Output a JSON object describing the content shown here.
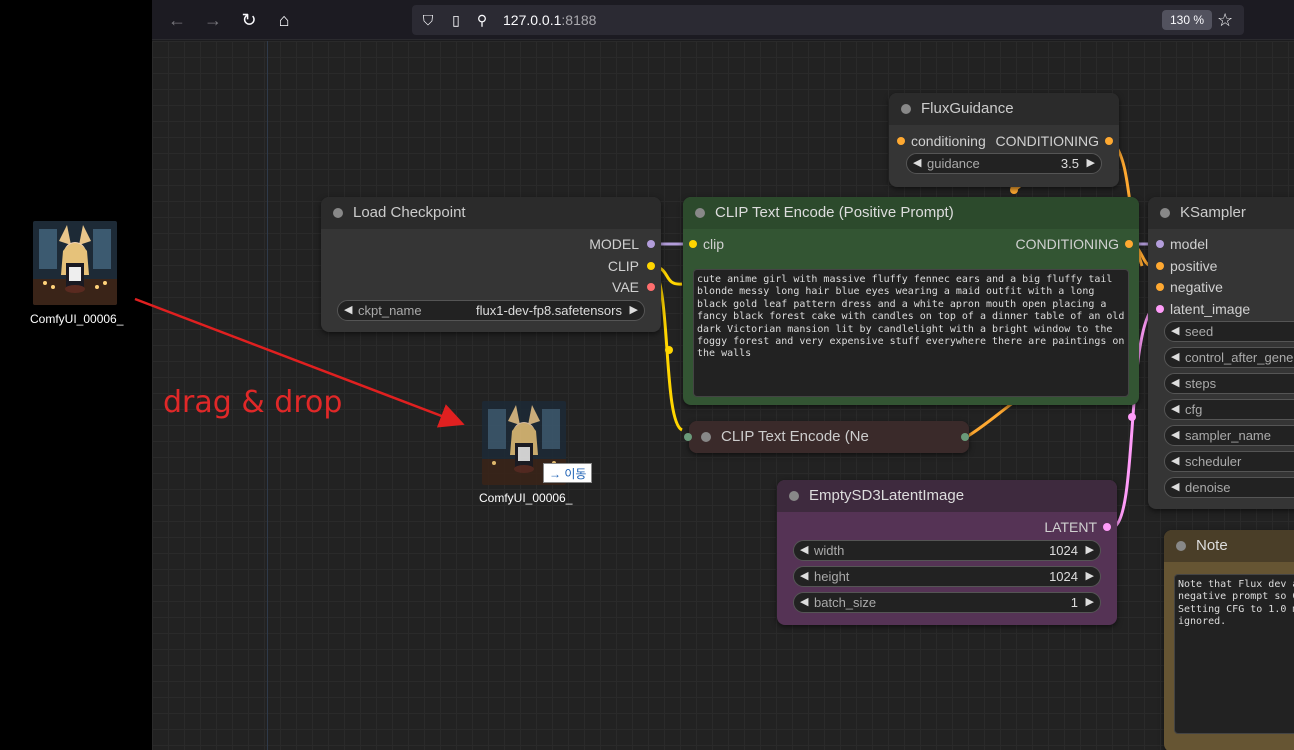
{
  "desktop": {
    "file_label": "ComfyUI_00006_",
    "drag_label": "drag & drop",
    "drag_tooltip": "→ 이동"
  },
  "browser": {
    "url_host": "127.0.0.1",
    "url_port": ":8188",
    "zoom": "130 %"
  },
  "nodes": {
    "flux_guidance": {
      "title": "FluxGuidance",
      "input": "conditioning",
      "output": "CONDITIONING",
      "widget_label": "guidance",
      "widget_value": "3.5"
    },
    "load_checkpoint": {
      "title": "Load Checkpoint",
      "outputs": [
        "MODEL",
        "CLIP",
        "VAE"
      ],
      "widget_label": "ckpt_name",
      "widget_value": "flux1-dev-fp8.safetensors"
    },
    "clip_positive": {
      "title": "CLIP Text Encode (Positive Prompt)",
      "input": "clip",
      "output": "CONDITIONING",
      "prompt": "cute anime girl with massive fluffy fennec ears and a big fluffy tail blonde messy long hair blue eyes wearing a maid outfit with a long black gold leaf pattern dress and a white apron mouth open placing a fancy black forest cake with candles on top of a dinner table of an old dark Victorian mansion lit by candlelight with a bright window to the foggy forest and very expensive stuff everywhere there are paintings on the walls"
    },
    "clip_negative": {
      "title": "CLIP Text Encode (Ne"
    },
    "ksampler": {
      "title": "KSampler",
      "inputs": [
        "model",
        "positive",
        "negative",
        "latent_image"
      ],
      "widgets": [
        "seed",
        "control_after_gene",
        "steps",
        "cfg",
        "sampler_name",
        "scheduler",
        "denoise"
      ]
    },
    "empty_latent": {
      "title": "EmptySD3LatentImage",
      "output": "LATENT",
      "widgets": [
        {
          "label": "width",
          "value": "1024"
        },
        {
          "label": "height",
          "value": "1024"
        },
        {
          "label": "batch_size",
          "value": "1"
        }
      ]
    },
    "note": {
      "title": "Note",
      "text": "Note that Flux dev a\nnegative prompt so C\nSetting CFG to 1.0 m\nignored."
    }
  },
  "colors": {
    "conditioning": "#ffa931",
    "model": "#b39ddb",
    "clip": "#ffd500",
    "vae": "#ff6e6e",
    "latent": "#ff9cf9",
    "clip_node_bg": "#335533",
    "latent_node_bg": "#553355",
    "note_node_bg": "#665533",
    "arrow": "#e02020"
  }
}
